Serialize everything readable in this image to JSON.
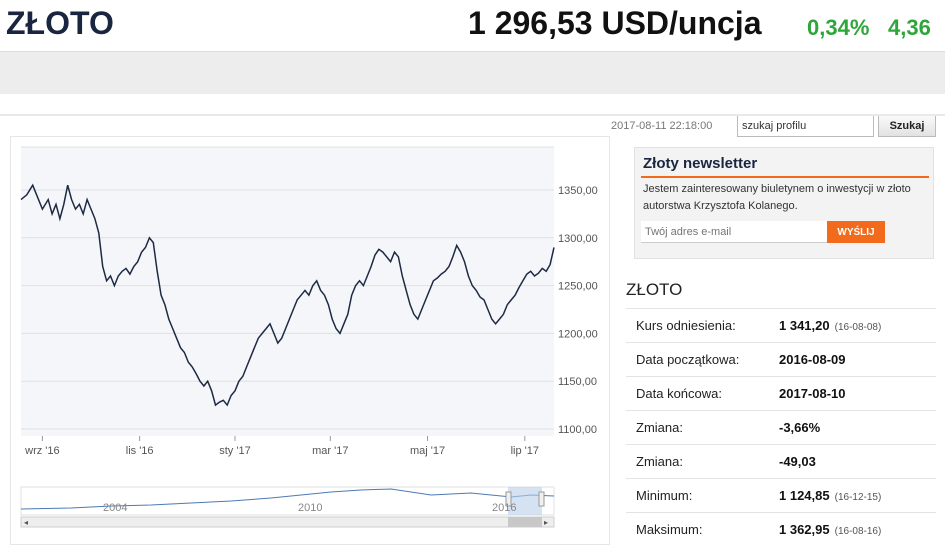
{
  "header": {
    "title": "ZŁOTO",
    "price": "1 296,53 USD/uncja",
    "change_pct": "0,34%",
    "change_abs": "4,36",
    "accent_color": "#2ea63a"
  },
  "subbar": {
    "timestamp": "2017-08-11 22:18:00",
    "search_value": "szukaj profilu",
    "search_button": "Szukaj"
  },
  "newsletter": {
    "title": "Złoty newsletter",
    "text": "Jestem zainteresowany biuletynem o inwestycji w złoto autorstwa Krzysztofa Kolanego.",
    "email_placeholder": "Twój adres e-mail",
    "submit_label": "WYŚLIJ",
    "accent_color": "#f26a1b"
  },
  "stats": {
    "title": "ZŁOTO",
    "rows": [
      {
        "label": "Kurs odniesienia:",
        "value": "1 341,20",
        "note": "(16-08-08)"
      },
      {
        "label": "Data początkowa:",
        "value": "2016-08-09",
        "note": ""
      },
      {
        "label": "Data końcowa:",
        "value": "2017-08-10",
        "note": ""
      },
      {
        "label": "Zmiana:",
        "value": "-3,66%",
        "note": ""
      },
      {
        "label": "Zmiana:",
        "value": "-49,03",
        "note": ""
      },
      {
        "label": "Minimum:",
        "value": "1 124,85",
        "note": "(16-12-15)"
      },
      {
        "label": "Maksimum:",
        "value": "1 362,95",
        "note": "(16-08-16)"
      }
    ]
  },
  "chart_data": {
    "type": "line",
    "title": "",
    "xlabel": "",
    "ylabel": "",
    "ylim": [
      1100,
      1350
    ],
    "y_ticks": [
      "1350,00",
      "1300,00",
      "1250,00",
      "1200,00",
      "1150,00",
      "1100,00"
    ],
    "y_tick_values": [
      1350,
      1300,
      1250,
      1200,
      1150,
      1100
    ],
    "x_ticks": [
      "wrz '16",
      "lis '16",
      "sty '17",
      "mar '17",
      "maj '17",
      "lip '17"
    ],
    "x_tick_index": [
      22,
      122,
      220,
      318,
      418,
      518
    ],
    "grid": true,
    "line_color": "#1e2a44",
    "series": [
      {
        "x_index": [
          0,
          6,
          12,
          16,
          22,
          28,
          32,
          36,
          40,
          44,
          48,
          52,
          56,
          60,
          64,
          68,
          72,
          76,
          80,
          84,
          88,
          92,
          96,
          100,
          104,
          108,
          112,
          116,
          120,
          124,
          128,
          132,
          136,
          140,
          144,
          148,
          152,
          156,
          160,
          164,
          168,
          172,
          176,
          180,
          184,
          188,
          192,
          196,
          200,
          204,
          208,
          212,
          216,
          220,
          224,
          228,
          232,
          236,
          240,
          244,
          248,
          252,
          256,
          260,
          264,
          268,
          272,
          276,
          280,
          284,
          288,
          292,
          296,
          300,
          304,
          308,
          312,
          316,
          320,
          324,
          328,
          332,
          336,
          340,
          344,
          348,
          352,
          356,
          360,
          364,
          368,
          372,
          376,
          380,
          384,
          388,
          392,
          396,
          400,
          404,
          408,
          412,
          416,
          420,
          424,
          428,
          432,
          436,
          440,
          444,
          448,
          452,
          456,
          460,
          464,
          468,
          472,
          476,
          480,
          484,
          488,
          492,
          496,
          500,
          504,
          508,
          512,
          516,
          520,
          524,
          528,
          532,
          536,
          540,
          544,
          548
        ],
        "values": [
          1340,
          1345,
          1355,
          1345,
          1330,
          1340,
          1325,
          1335,
          1320,
          1335,
          1355,
          1340,
          1330,
          1335,
          1325,
          1340,
          1330,
          1320,
          1305,
          1270,
          1255,
          1260,
          1250,
          1260,
          1265,
          1268,
          1262,
          1270,
          1275,
          1285,
          1290,
          1300,
          1295,
          1265,
          1240,
          1230,
          1215,
          1205,
          1195,
          1185,
          1180,
          1170,
          1165,
          1158,
          1150,
          1145,
          1150,
          1140,
          1125,
          1128,
          1130,
          1125,
          1135,
          1140,
          1150,
          1155,
          1165,
          1175,
          1185,
          1195,
          1200,
          1205,
          1210,
          1200,
          1190,
          1195,
          1205,
          1215,
          1225,
          1235,
          1240,
          1245,
          1240,
          1250,
          1255,
          1245,
          1240,
          1230,
          1215,
          1205,
          1200,
          1210,
          1220,
          1240,
          1250,
          1255,
          1250,
          1260,
          1270,
          1282,
          1288,
          1285,
          1280,
          1275,
          1285,
          1280,
          1260,
          1245,
          1230,
          1220,
          1215,
          1225,
          1235,
          1245,
          1255,
          1258,
          1262,
          1265,
          1270,
          1280,
          1292,
          1285,
          1275,
          1260,
          1250,
          1245,
          1238,
          1235,
          1225,
          1215,
          1210,
          1215,
          1220,
          1230,
          1235,
          1240,
          1248,
          1255,
          1262,
          1265,
          1260,
          1263,
          1268,
          1265,
          1272,
          1290
        ]
      }
    ],
    "navigator": {
      "x_labels": [
        "2004",
        "2010",
        "2016"
      ]
    }
  }
}
